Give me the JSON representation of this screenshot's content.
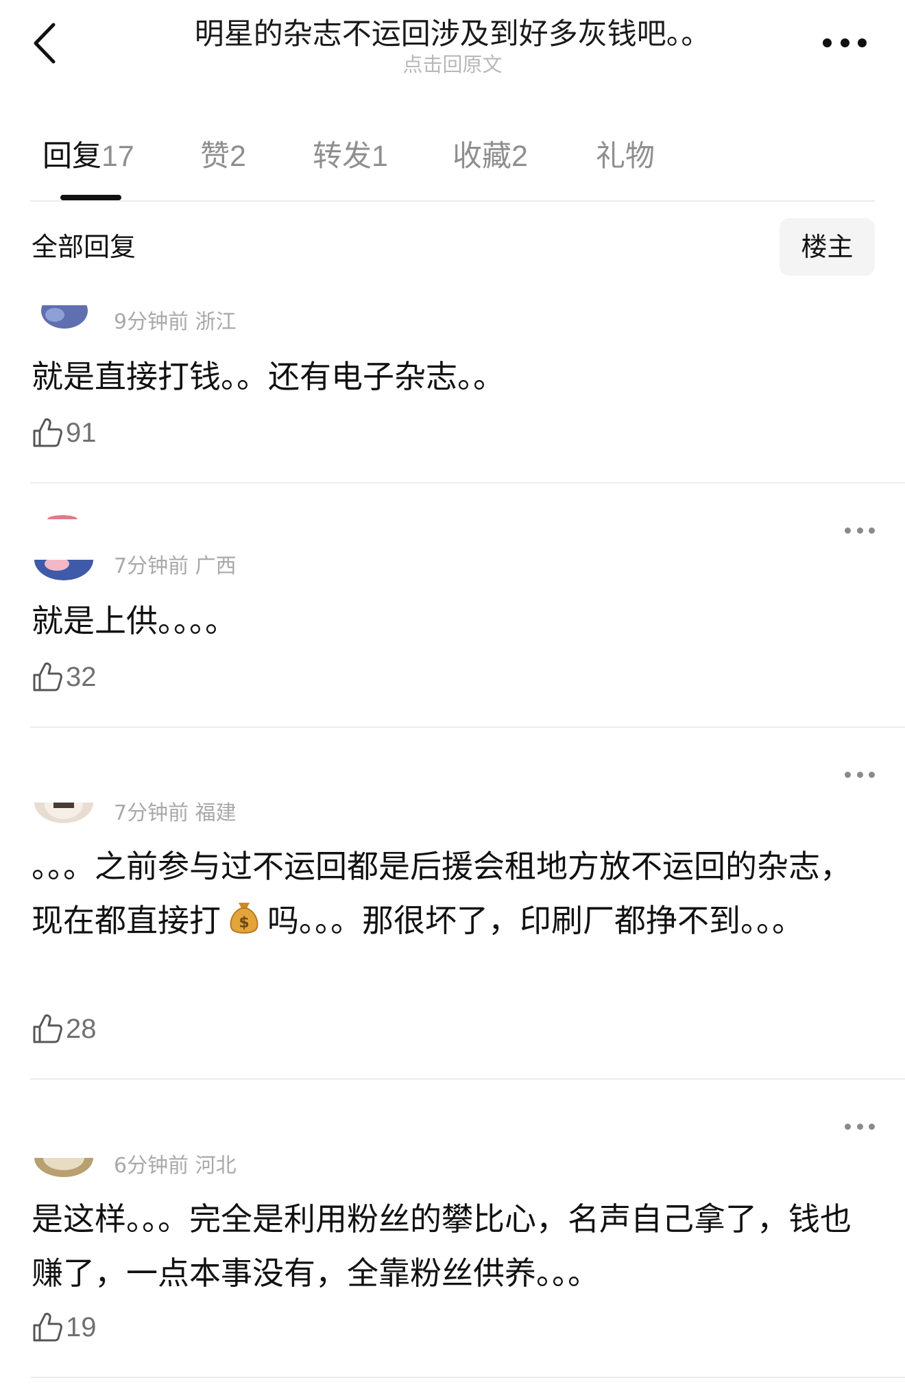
{
  "header": {
    "title": "明星的杂志不运回涉及到好多灰钱吧。。",
    "subtitle": "点击回原文"
  },
  "tabs": [
    {
      "label": "回复",
      "count": "17"
    },
    {
      "label": "赞",
      "count": "2"
    },
    {
      "label": "转发",
      "count": "1"
    },
    {
      "label": "收藏",
      "count": "2"
    },
    {
      "label": "礼物",
      "count": ""
    }
  ],
  "section": {
    "title": "全部回复",
    "filter_label": "楼主"
  },
  "comments": [
    {
      "meta": "9分钟前  浙江",
      "body": "就是直接打钱。。还有电子杂志。。",
      "likes": "91"
    },
    {
      "meta": "7分钟前  广西",
      "body": "就是上供。。。。",
      "likes": "32"
    },
    {
      "meta": "7分钟前  福建",
      "body_parts": [
        "。。。之前参与过不运回都是后援会租地方放不运回的杂志，现在都直接打",
        "吗。。。那很坏了，印刷厂都挣不到。。。"
      ],
      "emoji": "money-bag-icon",
      "likes": "28"
    },
    {
      "meta": "6分钟前  河北",
      "body": "是这样。。。完全是利用粉丝的攀比心，名声自己拿了，钱也赚了，一点本事没有，全靠粉丝供养。。。",
      "likes": "19"
    }
  ],
  "colors": {
    "text": "#111111",
    "muted": "#8f8f8f",
    "meta": "#a9a9a9",
    "divider": "#ececec"
  }
}
